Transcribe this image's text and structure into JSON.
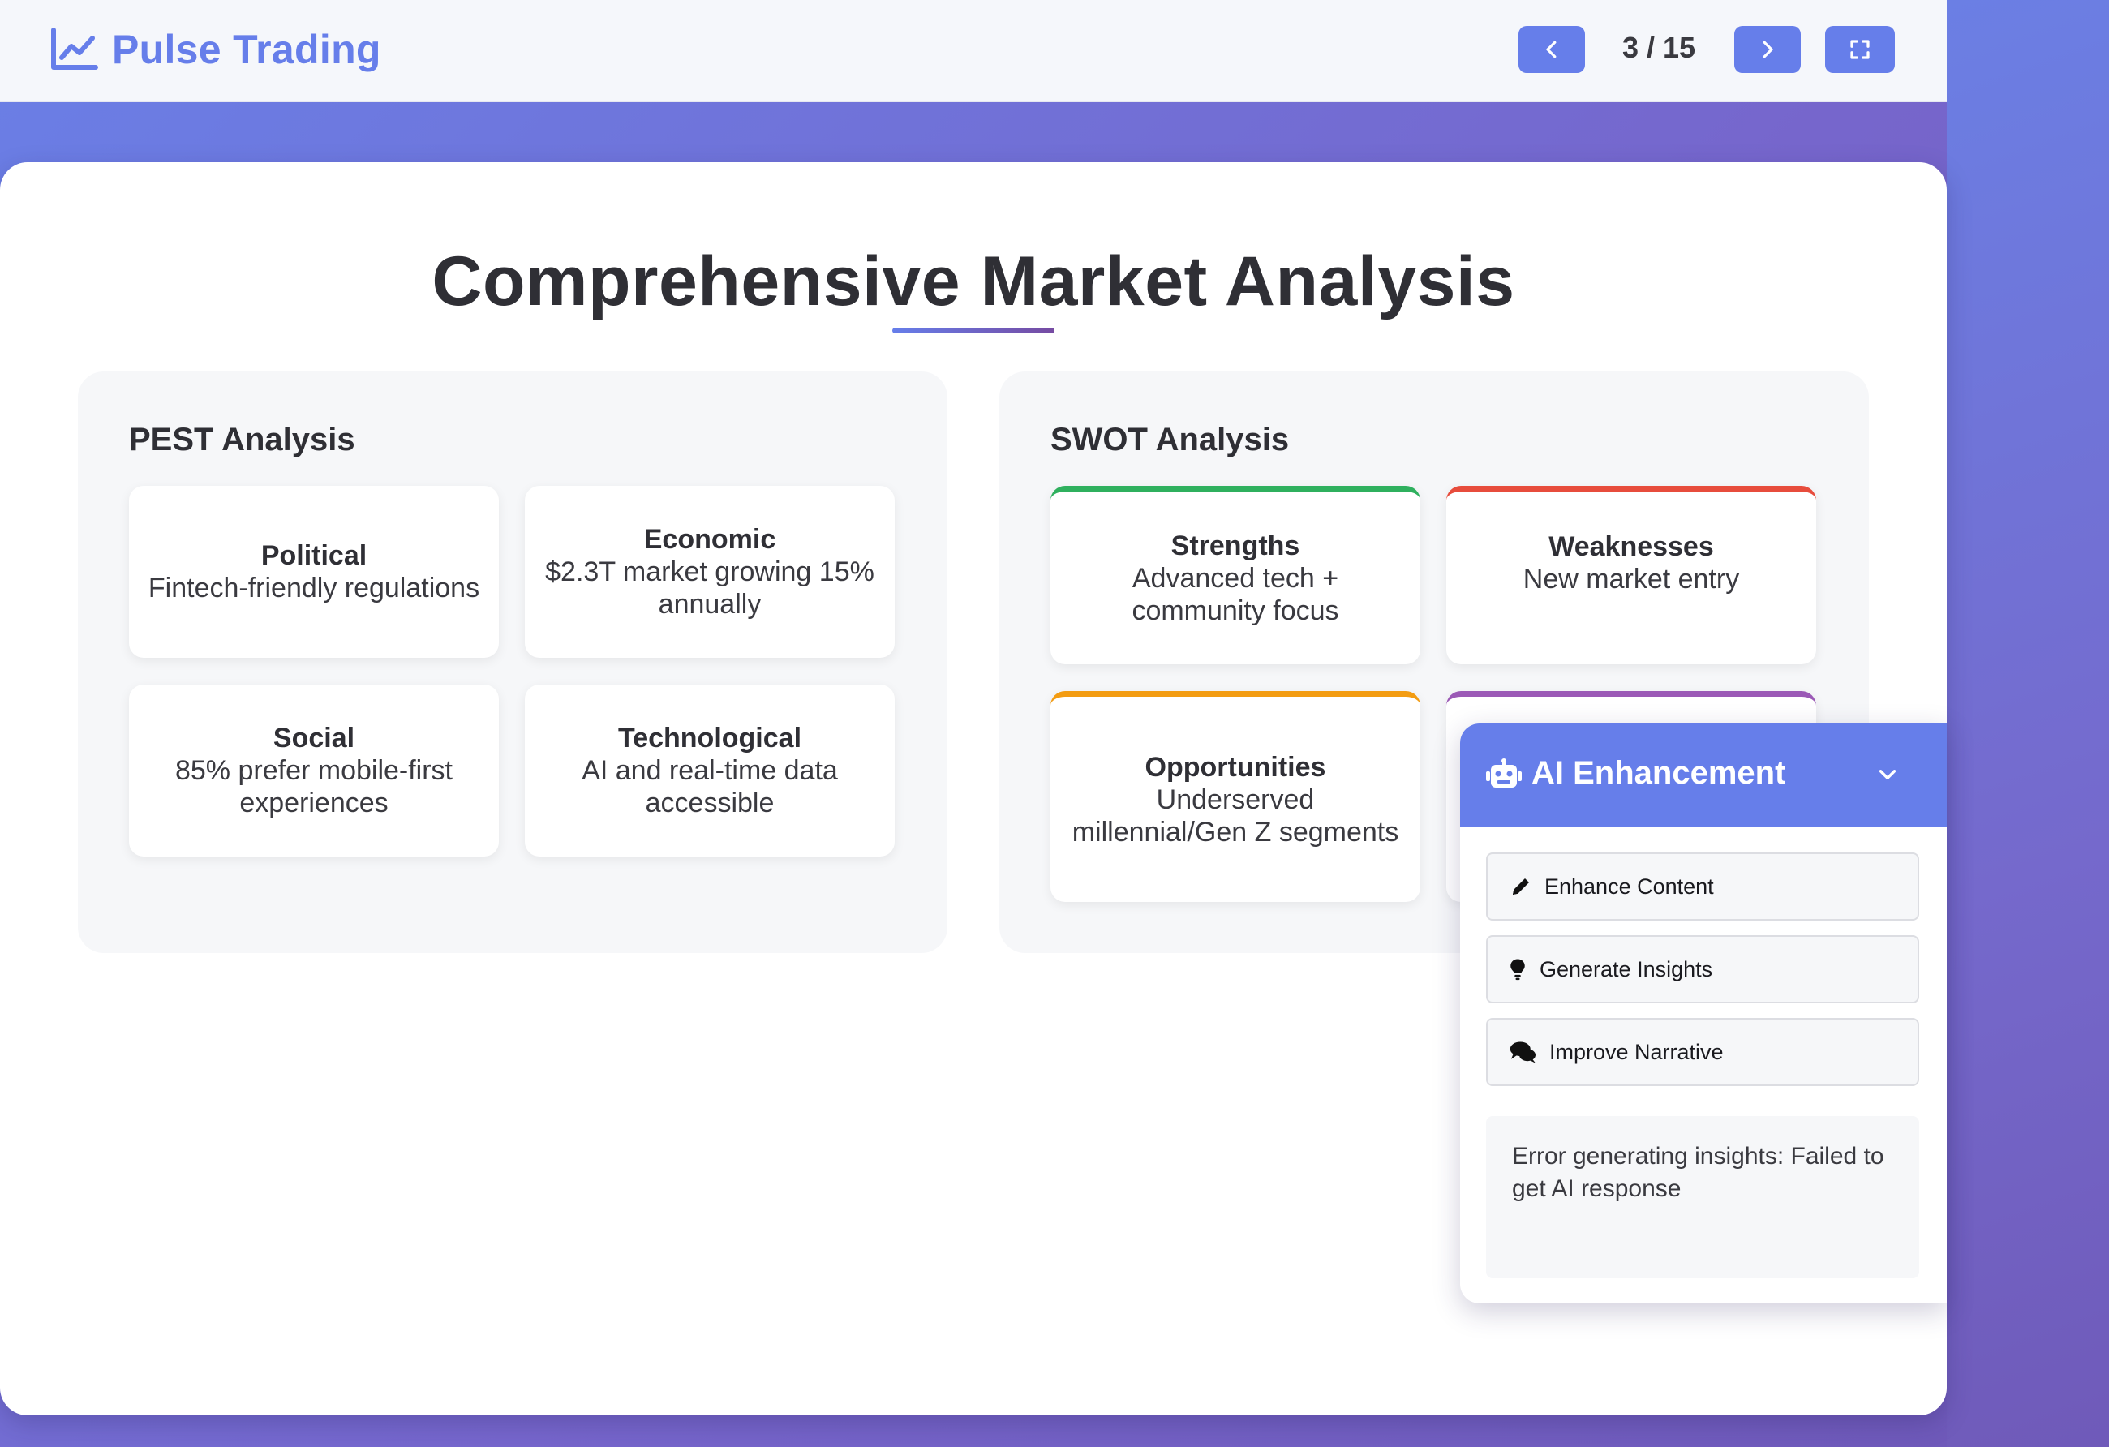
{
  "header": {
    "brand": "Pulse Trading",
    "slide_counter": "3 / 15"
  },
  "slide": {
    "title": "Comprehensive Market Analysis",
    "pest": {
      "heading": "PEST Analysis",
      "items": [
        {
          "title": "Political",
          "text": "Fintech-friendly regulations"
        },
        {
          "title": "Economic",
          "text": "$2.3T market growing 15% annually"
        },
        {
          "title": "Social",
          "text": "85% prefer mobile-first experiences"
        },
        {
          "title": "Technological",
          "text": "AI and real-time data accessible"
        }
      ]
    },
    "swot": {
      "heading": "SWOT Analysis",
      "items": [
        {
          "title": "Strengths",
          "text": "Advanced tech + community focus",
          "color": "#2fb05e"
        },
        {
          "title": "Weaknesses",
          "text": "New market entry",
          "color": "#e74c3c"
        },
        {
          "title": "Opportunities",
          "text": "Underserved millennial/Gen Z segments",
          "color": "#f39c12"
        },
        {
          "title": "",
          "text": "",
          "color": "#9b59b6"
        }
      ]
    }
  },
  "ai_panel": {
    "title": "AI Enhancement",
    "buttons": [
      {
        "label": "Enhance Content",
        "icon": "pencil-icon"
      },
      {
        "label": "Generate Insights",
        "icon": "lightbulb-icon"
      },
      {
        "label": "Improve Narrative",
        "icon": "comments-icon"
      }
    ],
    "message": "Error generating insights: Failed to get AI response"
  },
  "colors": {
    "accent": "#667eea",
    "accent_dark": "#764ba2"
  }
}
